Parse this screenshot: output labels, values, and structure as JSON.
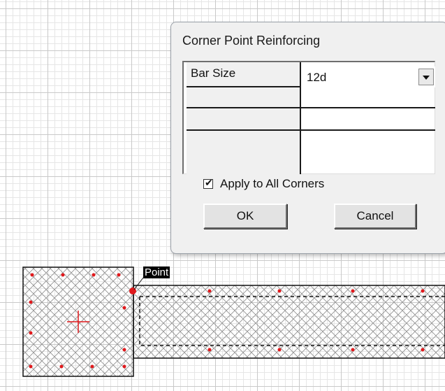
{
  "dialog": {
    "title": "Corner Point Reinforcing",
    "table": {
      "header_label": "Bar Size",
      "bar_size_value": "12d"
    },
    "apply_all_label": "Apply to All Corners",
    "apply_all_checked": true,
    "ok_label": "OK",
    "cancel_label": "Cancel"
  },
  "canvas": {
    "point_label": "Point"
  },
  "colors": {
    "accent_red": "#e0191c",
    "grid_line": "#c9c9c9",
    "dialog_bg": "#f0f0f0"
  }
}
